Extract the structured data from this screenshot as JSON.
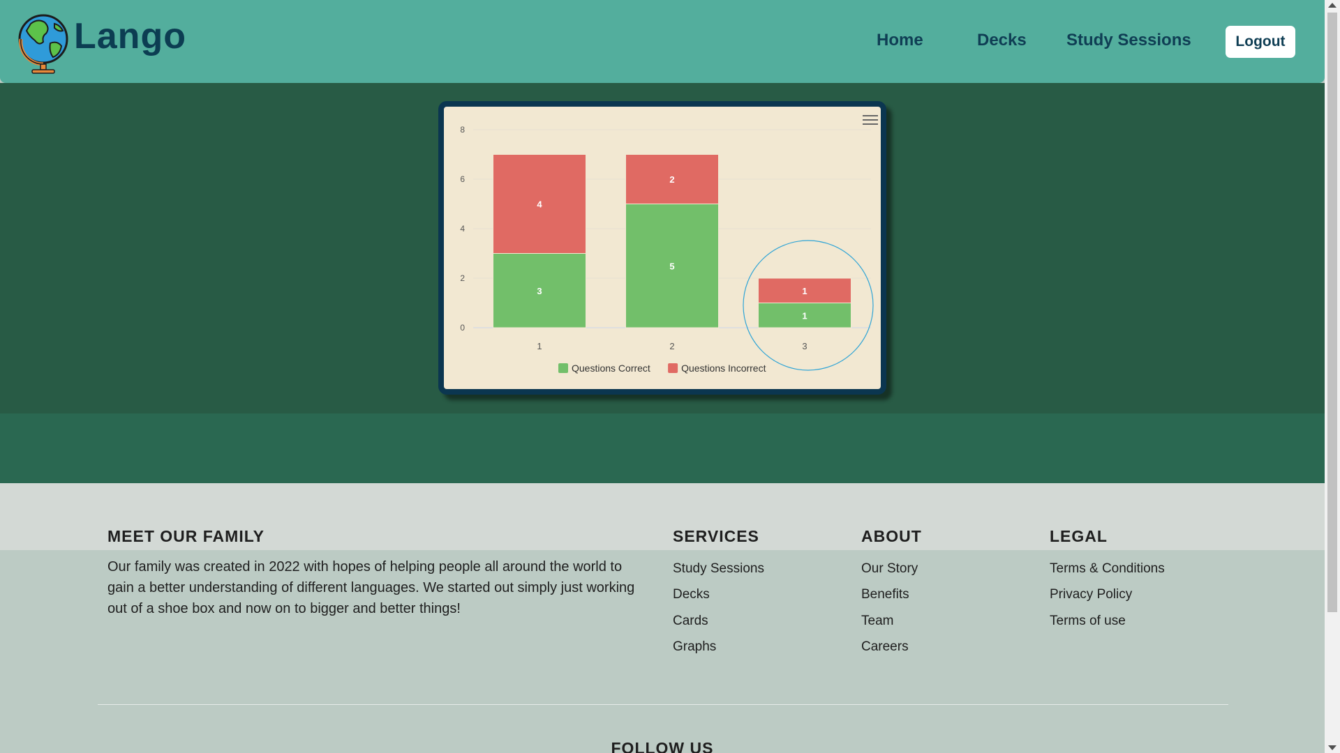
{
  "brand": {
    "name": "Lango",
    "icon": "globe-icon"
  },
  "nav": {
    "home": "Home",
    "decks": "Decks",
    "study_sessions": "Study Sessions",
    "logout": "Logout"
  },
  "chart_data": {
    "type": "bar",
    "stacked": true,
    "categories": [
      "1",
      "2",
      "3"
    ],
    "series": [
      {
        "name": "Questions Correct",
        "values": [
          3,
          5,
          1
        ],
        "color": "#72bf6a"
      },
      {
        "name": "Questions Incorrect",
        "values": [
          4,
          2,
          1
        ],
        "color": "#e06a63"
      }
    ],
    "y_ticks": [
      "0",
      "2",
      "4",
      "6",
      "8"
    ],
    "ylim": [
      0,
      8
    ],
    "legend_position": "bottom-center",
    "grid": true,
    "highlight_category": "3",
    "highlight_color": "#2fa4d6",
    "menu_icon": "hamburger-menu-icon"
  },
  "footer": {
    "family_heading": "MEET OUR FAMILY",
    "family_text": "Our family was created in 2022 with hopes of helping people all around the world to gain a better understanding of different languages. We started out simply just working out of a shoe box and now on to bigger and better things!",
    "services_heading": "SERVICES",
    "services": [
      "Study Sessions",
      "Decks",
      "Cards",
      "Graphs"
    ],
    "about_heading": "ABOUT",
    "about": [
      "Our Story",
      "Benefits",
      "Team",
      "Careers"
    ],
    "legal_heading": "LEGAL",
    "legal": [
      "Terms & Conditions",
      "Privacy Policy",
      "Terms of use"
    ],
    "follow_heading": "FOLLOW US"
  }
}
